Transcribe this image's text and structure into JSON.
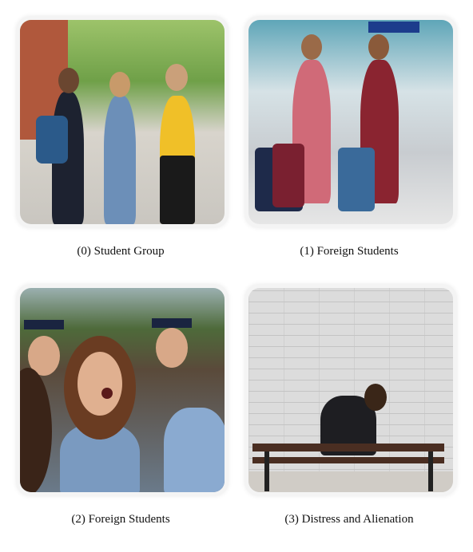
{
  "figures": [
    {
      "caption": "(0) Student Group"
    },
    {
      "caption": "(1) Foreign Students"
    },
    {
      "caption": "(2) Foreign Students"
    },
    {
      "caption": "(3) Distress and Alienation"
    }
  ]
}
